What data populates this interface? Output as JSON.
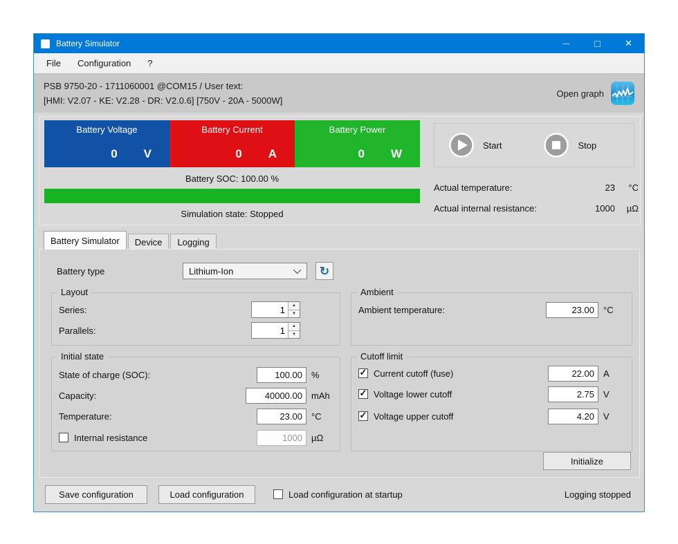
{
  "window": {
    "title": "Battery Simulator",
    "minimize_glyph": "—",
    "close_glyph": "✕"
  },
  "menu": {
    "file": "File",
    "configuration": "Configuration",
    "help": "?"
  },
  "device_info": {
    "line1": "PSB 9750-20 - 1711060001 @COM15 / User text:",
    "line2": "[HMI: V2.07 - KE: V2.28 - DR: V2.0.6] [750V - 20A - 5000W]",
    "open_graph_label": "Open graph"
  },
  "meters": [
    {
      "label": "Battery Voltage",
      "value": "0",
      "unit": "V",
      "color": "#1252a6"
    },
    {
      "label": "Battery Current",
      "value": "0",
      "unit": "A",
      "color": "#de1014"
    },
    {
      "label": "Battery Power",
      "value": "0",
      "unit": "W",
      "color": "#1fb42a"
    }
  ],
  "soc": {
    "label": "Battery SOC: 100.00 %",
    "percent": 100,
    "bar_color": "#17b322"
  },
  "simulation_state": "Simulation state: Stopped",
  "transport": {
    "start_label": "Start",
    "stop_label": "Stop"
  },
  "actuals": [
    {
      "label": "Actual temperature:",
      "value": "23",
      "unit": "°C"
    },
    {
      "label": "Actual internal resistance:",
      "value": "1000",
      "unit": "µΩ"
    }
  ],
  "tabs": [
    {
      "label": "Battery Simulator"
    },
    {
      "label": "Device"
    },
    {
      "label": "Logging"
    }
  ],
  "battery_type": {
    "label": "Battery type",
    "selected": "Lithium-Ion"
  },
  "layout_group": {
    "title": "Layout",
    "series_label": "Series:",
    "series_value": "1",
    "parallels_label": "Parallels:",
    "parallels_value": "1"
  },
  "ambient_group": {
    "title": "Ambient",
    "temp_label": "Ambient temperature:",
    "temp_value": "23.00",
    "temp_unit": "°C"
  },
  "initial_group": {
    "title": "Initial state",
    "soc_label": "State of charge (SOC):",
    "soc_value": "100.00",
    "soc_unit": "%",
    "capacity_label": "Capacity:",
    "capacity_value": "40000.00",
    "capacity_unit": "mAh",
    "temp_label": "Temperature:",
    "temp_value": "23.00",
    "temp_unit": "°C",
    "resistance_label": "Internal resistance",
    "resistance_value": "1000",
    "resistance_unit": "µΩ",
    "resistance_checked": false
  },
  "cutoff_group": {
    "title": "Cutoff limit",
    "current_label": "Current cutoff (fuse)",
    "current_value": "22.00",
    "current_unit": "A",
    "current_checked": true,
    "lower_label": "Voltage lower cutoff",
    "lower_value": "2.75",
    "lower_unit": "V",
    "lower_checked": true,
    "upper_label": "Voltage upper cutoff",
    "upper_value": "4.20",
    "upper_unit": "V",
    "upper_checked": true
  },
  "buttons": {
    "initialize": "Initialize",
    "save": "Save configuration",
    "load": "Load configuration"
  },
  "startup_checkbox": {
    "label": "Load configuration at startup",
    "checked": false
  },
  "status": "Logging stopped"
}
